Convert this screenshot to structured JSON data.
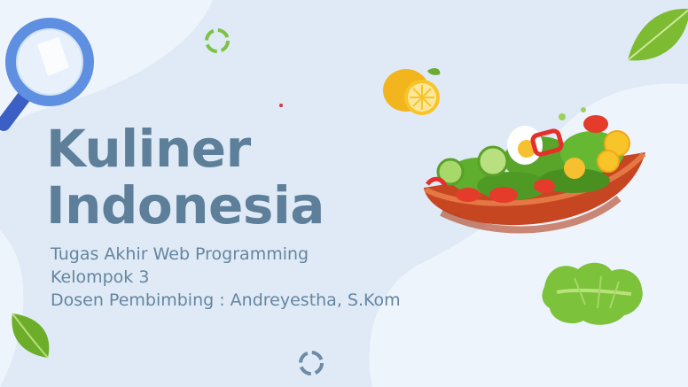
{
  "slide": {
    "title_line1": "Kuliner",
    "title_line2": "Indonesia",
    "subtitle_lines": [
      "Tugas Akhir Web Programming",
      "Kelompok 3",
      "Dosen Pembimbing : Andreyestha, S.Kom"
    ]
  },
  "icons": [
    "magnifier-icon",
    "leaf-icon",
    "lemon-icon",
    "salad-bowl-icon",
    "lettuce-icon",
    "loading-ring-icon"
  ],
  "colors": {
    "background": "#dfeaf6",
    "blob_light": "#eef4fb",
    "title": "#5e7f99",
    "subtitle": "#6585a0",
    "leaf_green": "#6cae2a",
    "ring_green": "#7cc243",
    "ring_blue": "#6e8ba6",
    "bowl_orange": "#d9582b"
  }
}
